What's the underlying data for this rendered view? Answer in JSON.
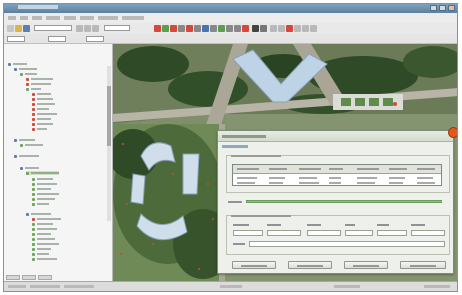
{
  "window": {
    "title": ""
  },
  "menubar": {
    "items": [
      "",
      "",
      "",
      "",
      "",
      "",
      "",
      ""
    ]
  },
  "colors": {
    "titlebar": "#6f91ad",
    "dialog_close": "#e05a1e",
    "map_vegetation": "#2f4a26",
    "map_grass": "#8fa66c",
    "map_roof": "#bfd3e6",
    "progress_fill": "#8cc37c"
  },
  "icons": {
    "close": "close-icon",
    "minimize": "minimize-icon",
    "maximize": "maximize-icon",
    "tree_layer": "layer-icon"
  },
  "dialog": {
    "title": "",
    "close_icon": "close-icon"
  },
  "status": {
    "text": ""
  }
}
